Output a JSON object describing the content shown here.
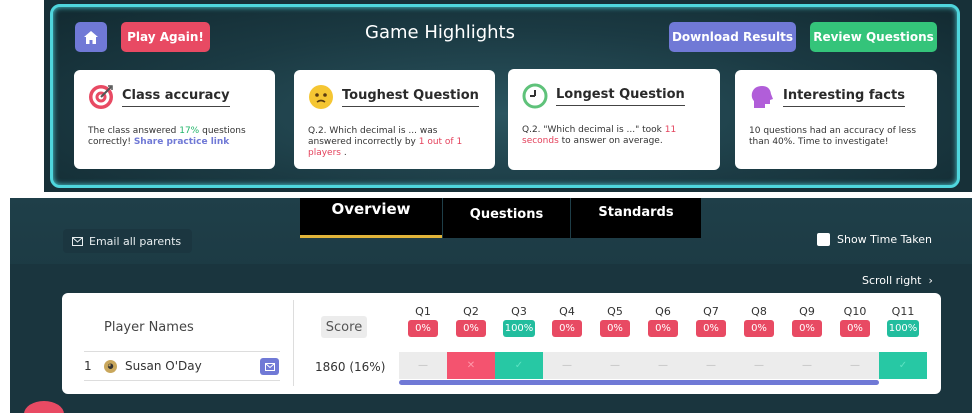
{
  "highlights": {
    "title": "Game Highlights",
    "home_icon": "home-icon",
    "play_again": "Play Again!",
    "download_results": "Download Results",
    "review_questions": "Review Questions",
    "cards": [
      {
        "title": "Class accuracy",
        "icon": "target-icon",
        "text_before": "The class answered ",
        "text_highlight": "17%",
        "text_after": " questions correctly! ",
        "link": "Share practice link"
      },
      {
        "title": "Toughest Question",
        "icon": "confused-face-icon",
        "text_before": "Q.2. Which decimal is ... was answered incorrectly by ",
        "text_highlight": "1 out of 1 players",
        "text_after": " ."
      },
      {
        "title": "Longest Question",
        "icon": "timer-icon",
        "text_before": "Q.2. \"Which decimal is ...\" took ",
        "text_highlight": "11 seconds",
        "text_after": " to answer on average."
      },
      {
        "title": "Interesting facts",
        "icon": "head-icon",
        "text_before": "10 questions had an accuracy of less than 40%. Time to investigate!"
      }
    ],
    "colors": {
      "accent_purple": "#7079d6",
      "accent_red": "#e84a63",
      "accent_green": "#34c47a",
      "glow": "#4fd6dd"
    }
  },
  "report": {
    "tabs": [
      "Overview",
      "Questions",
      "Standards"
    ],
    "active_tab": "Overview",
    "email_all_parents": "Email all parents",
    "show_time_taken": "Show Time Taken",
    "scroll_right": "Scroll right",
    "headers": {
      "player_names": "Player Names",
      "score": "Score"
    },
    "questions": [
      {
        "label": "Q1",
        "accuracy": "0%"
      },
      {
        "label": "Q2",
        "accuracy": "0%"
      },
      {
        "label": "Q3",
        "accuracy": "100%"
      },
      {
        "label": "Q4",
        "accuracy": "0%"
      },
      {
        "label": "Q5",
        "accuracy": "0%"
      },
      {
        "label": "Q6",
        "accuracy": "0%"
      },
      {
        "label": "Q7",
        "accuracy": "0%"
      },
      {
        "label": "Q8",
        "accuracy": "0%"
      },
      {
        "label": "Q9",
        "accuracy": "0%"
      },
      {
        "label": "Q10",
        "accuracy": "0%"
      },
      {
        "label": "Q11",
        "accuracy": "100%"
      }
    ],
    "players": [
      {
        "number": "1",
        "name": "Susan O'Day",
        "score": "1860 (16%)",
        "results": [
          "unanswered",
          "wrong",
          "correct",
          "unanswered",
          "unanswered",
          "unanswered",
          "unanswered",
          "unanswered",
          "unanswered",
          "unanswered",
          "correct"
        ]
      }
    ],
    "result_marks": {
      "unanswered": "—",
      "wrong": "✕",
      "correct": "✓"
    }
  }
}
